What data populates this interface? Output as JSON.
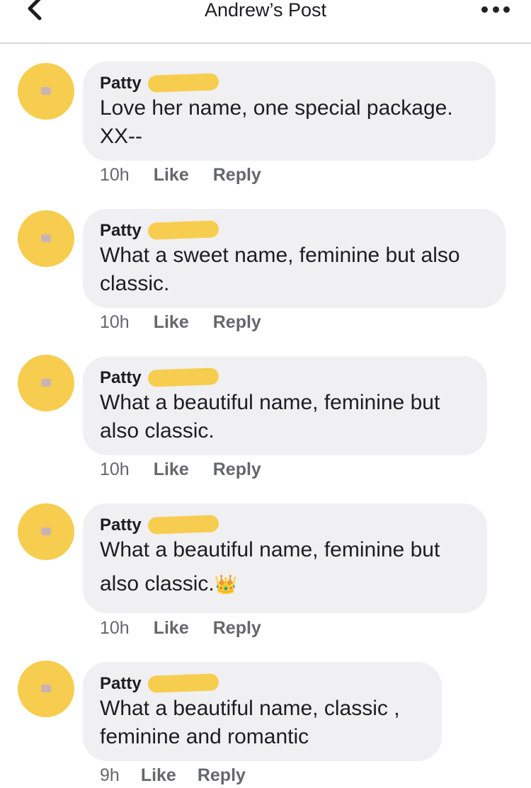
{
  "header": {
    "title": "Andrew’s Post",
    "back_icon": "chevron-left-icon",
    "more_icon": "ellipsis-icon"
  },
  "comments": [
    {
      "name": "Patty",
      "text": "Love her name, one special package. XX--",
      "time": "10h",
      "like": "Like",
      "reply": "Reply"
    },
    {
      "name": "Patty",
      "text": "What a sweet name, feminine but also classic.",
      "time": "10h",
      "like": "Like",
      "reply": "Reply"
    },
    {
      "name": "Patty",
      "text": "What a beautiful name, feminine but also classic.",
      "time": "10h",
      "like": "Like",
      "reply": "Reply"
    },
    {
      "name": "Patty",
      "text": "What a beautiful name, feminine but also classic.",
      "emoji": "👑",
      "time": "10h",
      "like": "Like",
      "reply": "Reply"
    },
    {
      "name": "Patty",
      "text": "What a beautiful name, classic , feminine and romantic",
      "time": "9h",
      "like": "Like",
      "reply": "Reply"
    }
  ],
  "colors": {
    "redaction": "#f6cd4e",
    "bubble": "#f0f0f2",
    "meta": "#65676b"
  }
}
